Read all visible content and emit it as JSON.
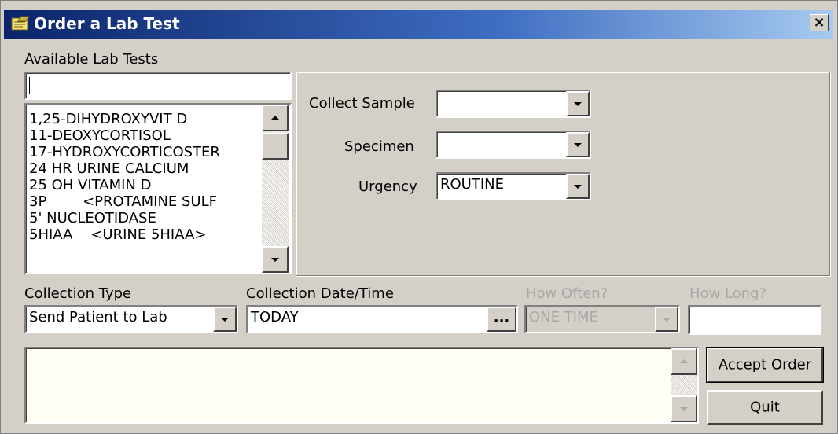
{
  "window": {
    "title": "Order a Lab Test",
    "close_glyph": "×",
    "title_icon": "notepad-icon"
  },
  "available_tests": {
    "label": "Available Lab Tests",
    "search_value": "",
    "items": [
      "1,25-DIHYDROXYVIT D",
      "11-DEOXYCORTISOL",
      "17-HYDROXYCORTICOSTER",
      "24 HR URINE CALCIUM",
      "25 OH VITAMIN D",
      "3P        <PROTAMINE SULF",
      "5' NUCLEOTIDASE",
      "5HIAA    <URINE 5HIAA>"
    ]
  },
  "details": {
    "collect_sample": {
      "label": "Collect Sample",
      "value": ""
    },
    "specimen": {
      "label": "Specimen",
      "value": ""
    },
    "urgency": {
      "label": "Urgency",
      "value": "ROUTINE"
    }
  },
  "collection": {
    "type": {
      "label": "Collection Type",
      "value": "Send Patient to Lab"
    },
    "datetime": {
      "label": "Collection Date/Time",
      "value": "TODAY",
      "button": "..."
    },
    "how_often": {
      "label": "How Often?",
      "value": "ONE TIME",
      "enabled": false
    },
    "how_long": {
      "label": "How Long?",
      "value": "",
      "enabled": false
    }
  },
  "order_text": "",
  "buttons": {
    "accept": "Accept Order",
    "quit": "Quit"
  },
  "colors": {
    "title_gradient_start": "#0a246a",
    "title_gradient_end": "#a6caf0",
    "face": "#d4d0c8",
    "disabled_text": "#a8a8a8"
  }
}
